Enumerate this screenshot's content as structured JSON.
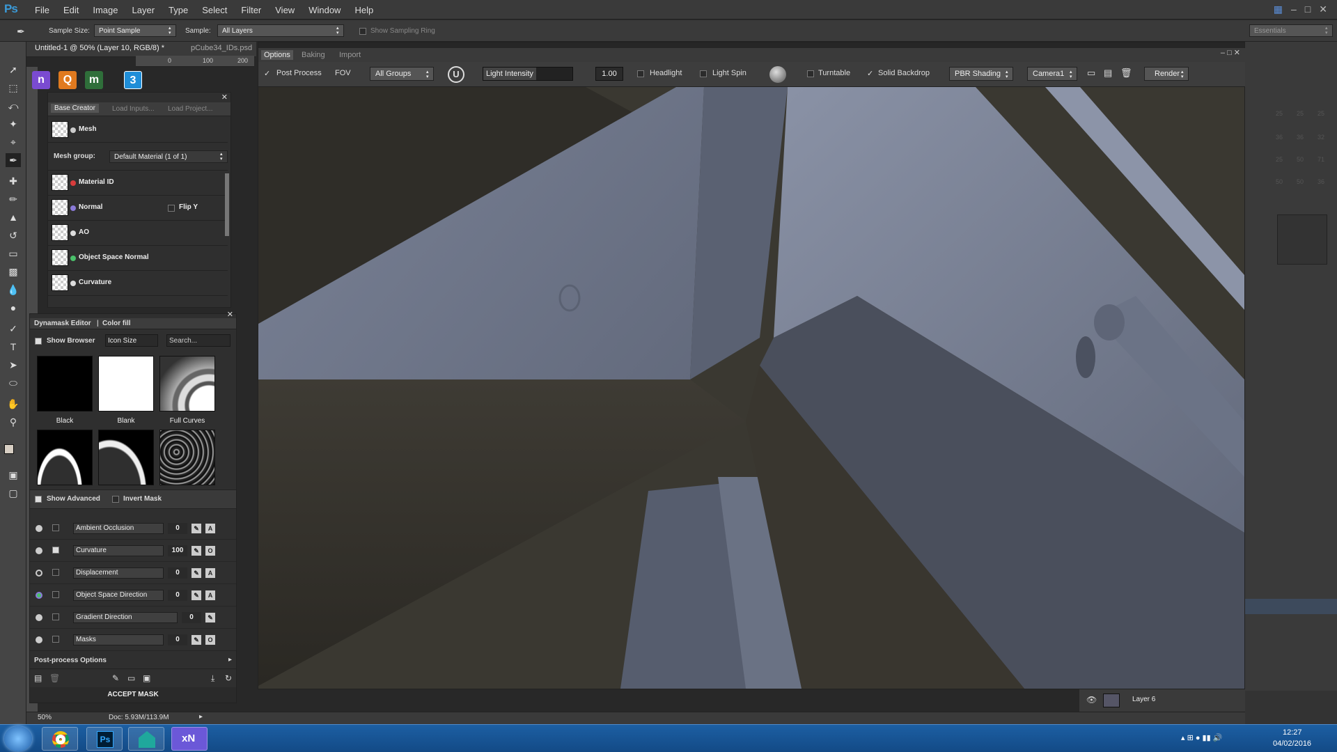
{
  "app": {
    "logo": "Ps",
    "menus": [
      "File",
      "Edit",
      "Image",
      "Layer",
      "Type",
      "Select",
      "Filter",
      "View",
      "Window",
      "Help"
    ],
    "window_controls": [
      "–",
      "□",
      "✕"
    ]
  },
  "options_bar": {
    "sample_size_label": "Sample Size:",
    "sample_size_value": "Point Sample",
    "sample_label": "Sample:",
    "sample_value": "All Layers",
    "show_sampling_ring": "Show Sampling Ring",
    "workspace": "Essentials"
  },
  "doc_tabs": [
    "Untitled-1 @ 50% (Layer 10, RGB/8) *",
    "pCube34_IDs.psd"
  ],
  "ruler_ticks": [
    "0",
    "100",
    "200"
  ],
  "app_icons": [
    {
      "label": "n",
      "color": "#7a4bd1"
    },
    {
      "label": "Q",
      "color": "#e07a1f"
    },
    {
      "label": "m",
      "color": "#2f6f3a"
    },
    {
      "label": "3",
      "color": "#1f8ed8"
    }
  ],
  "base_creator": {
    "tabs": [
      "Base Creator",
      "Load Inputs...",
      "Load Project..."
    ],
    "mesh_label": "Mesh",
    "mesh_group_label": "Mesh group:",
    "mesh_group_value": "Default Material (1 of 1)",
    "flip_y": "Flip Y",
    "maps": [
      {
        "label": "Material ID",
        "dot": "#d83c3c"
      },
      {
        "label": "Normal",
        "dot": "#8a7ad8"
      },
      {
        "label": "AO",
        "dot": "#dddddd"
      },
      {
        "label": "Object Space Normal",
        "dot": "#4ac06a"
      },
      {
        "label": "Curvature",
        "dot": "#dddddd"
      }
    ]
  },
  "dynamask": {
    "title_a": "Dynamask Editor",
    "title_b": "Color fill",
    "show_browser": "Show Browser",
    "icon_size": "Icon Size",
    "search_placeholder": "Search...",
    "presets": [
      "Black",
      "Blank",
      "Full Curves"
    ],
    "show_advanced": "Show Advanced",
    "invert_mask": "Invert Mask",
    "layers": [
      {
        "name": "Ambient Occlusion",
        "value": "0",
        "btn": "A"
      },
      {
        "name": "Curvature",
        "value": "100",
        "btn": "O"
      },
      {
        "name": "Displacement",
        "value": "0",
        "btn": "A"
      },
      {
        "name": "Object Space Direction",
        "value": "0",
        "btn": "A"
      },
      {
        "name": "Gradient Direction",
        "value": "0",
        "btn": ""
      },
      {
        "name": "Masks",
        "value": "0",
        "btn": "O"
      }
    ],
    "post_process": "Post-process Options",
    "accept": "ACCEPT MASK"
  },
  "viewport": {
    "tabs": [
      "Options",
      "Baking",
      "Import"
    ],
    "post_process": "Post Process",
    "fov": "FOV",
    "groups": "All Groups",
    "light_intensity": "Light Intensity",
    "light_value": "1.00",
    "headlight": "Headlight",
    "light_spin": "Light Spin",
    "turntable": "Turntable",
    "solid_backdrop": "Solid Backdrop",
    "shading": "PBR Shading",
    "camera": "Camera1",
    "render": "Render"
  },
  "right_panel": {
    "layer_name": "Layer 6",
    "numbers": [
      "25",
      "25",
      "25",
      "36",
      "36",
      "32",
      "25",
      "50",
      "71",
      "50",
      "50",
      "36"
    ]
  },
  "status": {
    "zoom": "50%",
    "doc": "Doc: 5.93M/113.9M"
  },
  "taskbar": {
    "time": "12:27",
    "date": "04/02/2016",
    "apps": [
      "Ps",
      "xN"
    ]
  }
}
